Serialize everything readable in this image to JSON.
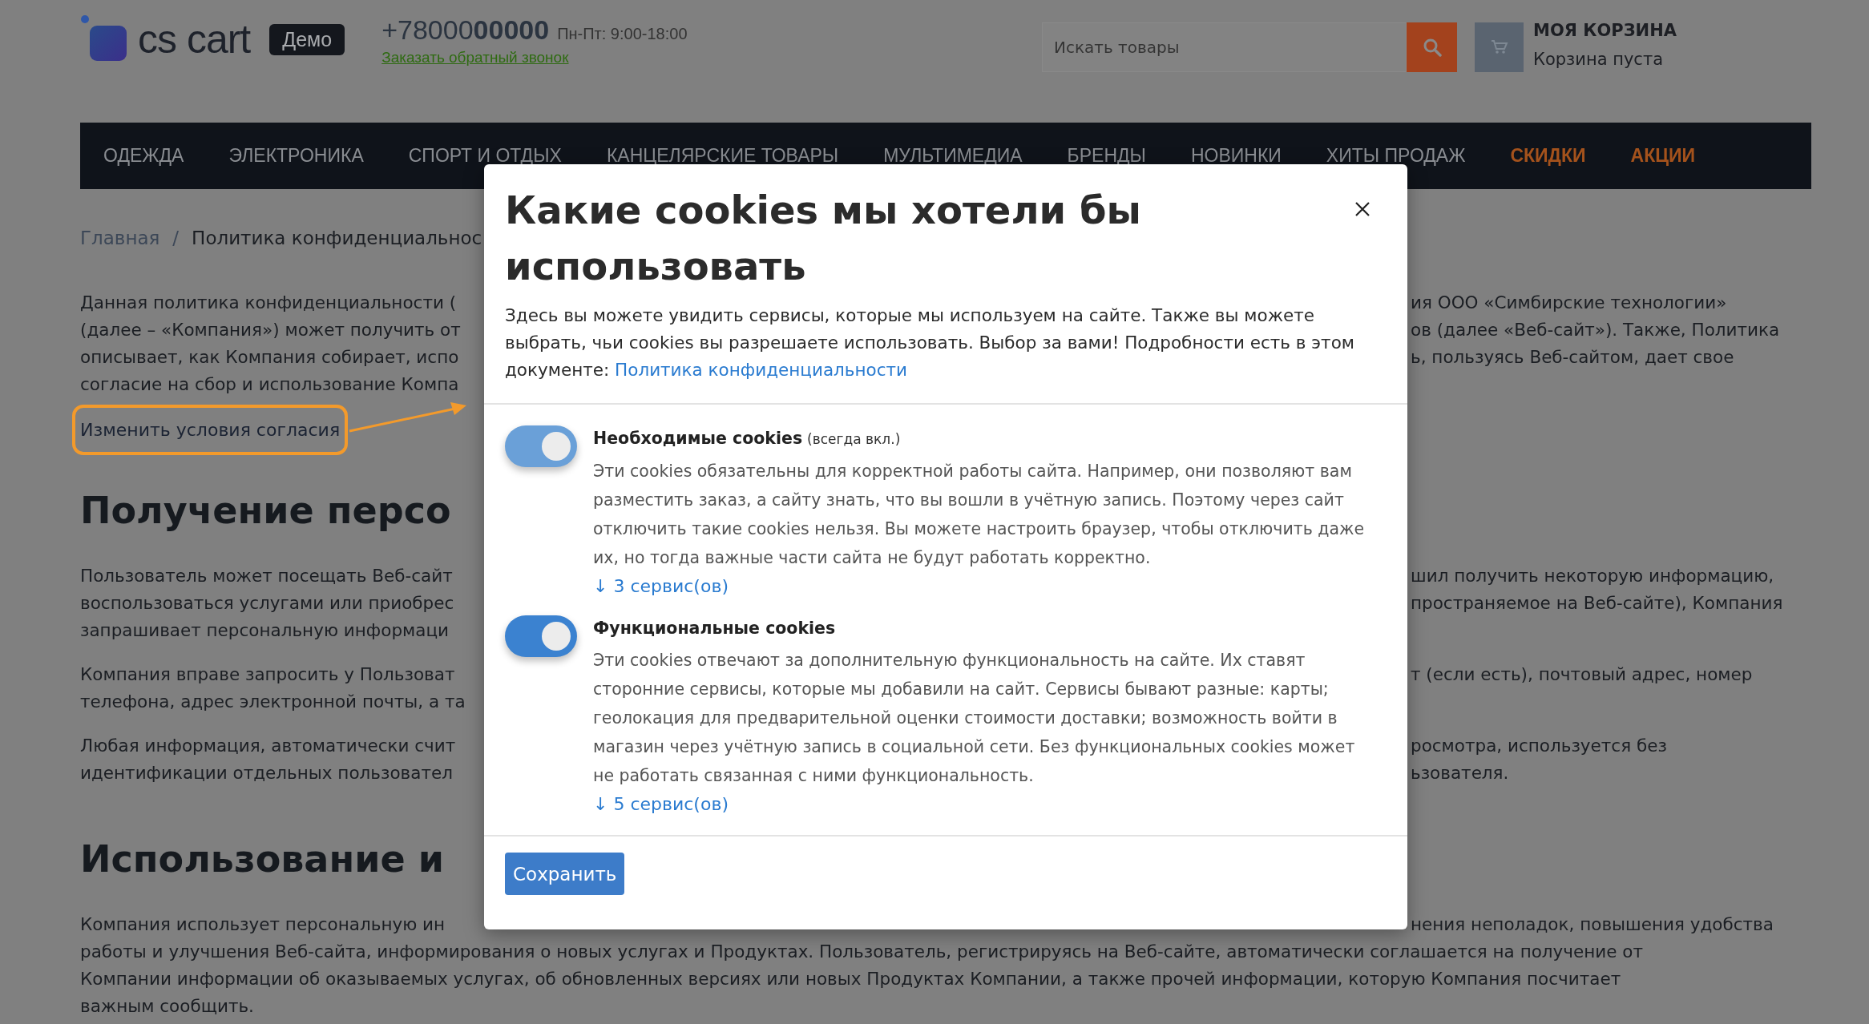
{
  "header": {
    "logo_text": "cs cart",
    "badge": "Демо",
    "phone": "+78000**00000**",
    "hours": "Пн-Пт: 9:00-18:00",
    "callback_link": "Заказать обратный звонок",
    "search": {
      "placeholder": "Искать товары"
    },
    "cart": {
      "title": "МОЯ КОРЗИНА",
      "status": "Корзина пуста"
    }
  },
  "nav": [
    {
      "label": "ОДЕЖДА",
      "highlight": false
    },
    {
      "label": "ЭЛЕКТРОНИКА",
      "highlight": false
    },
    {
      "label": "СПОРТ И ОТДЫХ",
      "highlight": false
    },
    {
      "label": "КАНЦЕЛЯРСКИЕ ТОВАРЫ",
      "highlight": false
    },
    {
      "label": "МУЛЬТИМЕДИА",
      "highlight": false
    },
    {
      "label": "БРЕНДЫ",
      "highlight": false
    },
    {
      "label": "НОВИНКИ",
      "highlight": false
    },
    {
      "label": "ХИТЫ ПРОДАЖ",
      "highlight": false
    },
    {
      "label": "СКИДКИ",
      "highlight": true
    },
    {
      "label": "АКЦИИ",
      "highlight": true
    }
  ],
  "breadcrumb": {
    "home": "Главная",
    "separator": "/",
    "current": "Политика конфиденциальнос"
  },
  "content": [
    {
      "kind": "paragraph",
      "lines": [
        {
          "left": "Данная политика конфиденциальности (",
          "right": "ия ООО «Симбирские технологии»"
        },
        {
          "left": "(далее – «Компания») может получить от",
          "right": "ов (далее «Веб-сайт»). Также, Политика"
        },
        {
          "left": "описывает, как Компания собирает, испо",
          "right": "ь, пользуясь Веб-сайтом, дает свое"
        },
        {
          "left": "согласие на сбор и использование Компа"
        }
      ]
    },
    {
      "kind": "consent_link",
      "text": "Изменить условия согласия"
    },
    {
      "kind": "heading",
      "text": "Получение персо"
    },
    {
      "kind": "paragraph",
      "lines": [
        {
          "left": "Пользователь может посещать Веб-сайт",
          "right": "шил получить некоторую информацию,"
        },
        {
          "left": "воспользоваться услугами или приобрес",
          "right": "пространяемое на Веб-сайте), Компания"
        },
        {
          "left": "запрашивает персональную информаци"
        }
      ]
    },
    {
      "kind": "paragraph",
      "lines": [
        {
          "left": "Компания вправе запросить у Пользоват",
          "right": "т (если есть), почтовый адрес, номер"
        },
        {
          "left": "телефона, адрес электронной почты, а та"
        }
      ]
    },
    {
      "kind": "paragraph",
      "lines": [
        {
          "left": "Любая информация, автоматически счит",
          "right": "росмотра, используется без"
        },
        {
          "left": "идентификации отдельных пользовател",
          "right": "ьзователя."
        }
      ]
    },
    {
      "kind": "heading",
      "text": "Использование и"
    },
    {
      "kind": "paragraph",
      "lines": [
        {
          "left": "Компания использует персональную ин",
          "right": "нения неполадок, повышения удобства"
        },
        {
          "full": "работы и улучшения Веб-сайта, информирования о новых услугах и Продуктах. Пользователь, регистрируясь на Веб-сайте, автоматически соглашается на получение от"
        },
        {
          "full": "Компании информации об оказываемых услугах, об обновленных версиях или новых Продуктах Компании, а также прочей информации, которую Компания посчитает"
        },
        {
          "full": "важным сообщить."
        }
      ]
    }
  ],
  "modal": {
    "title": "Какие cookies мы хотели бы использовать",
    "intro": "Здесь вы можете увидить сервисы, которые мы используем на сайте. Также вы можете выбрать, чьи cookies вы разрешаете использовать. Выбор за вами! Подробности есть в этом документе:",
    "intro_link": "Политика конфиденциальности",
    "sections": [
      {
        "title": "Необходимые cookies",
        "note": "(всегда вкл.)",
        "on": true,
        "disabled": true,
        "description": "Эти cookies обязательны для корректной работы сайта. Например, они позволяют вам разместить заказ, а сайту знать, что вы вошли в учётную запись. Поэтому через сайт отключить такие cookies нельзя. Вы можете настроить браузер, чтобы отключить даже их, но тогда важные части сайта не будут работать корректно.",
        "services": "↓ 3 сервис(ов)"
      },
      {
        "title": "Функциональные cookies",
        "on": true,
        "disabled": false,
        "description": "Эти cookies отвечают за дополнительную функциональность на сайте. Их ставят сторонние сервисы, которые мы добавили на сайт. Сервисы бывают разные: карты; геолокация для предварительной оценки стоимости доставки; возможность войти в магазин через учётную запись в социальной сети. Без функциональных cookies может не работать связанная с ними функциональность.",
        "services": "↓ 5 сервис(ов)"
      }
    ],
    "save_button": "Сохранить"
  }
}
